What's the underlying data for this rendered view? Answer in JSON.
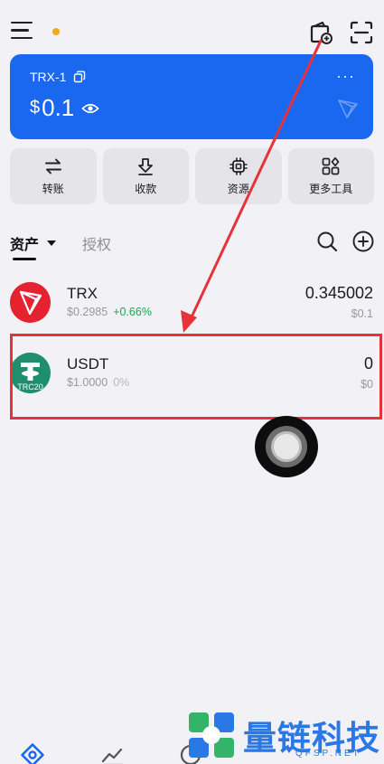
{
  "wallet": {
    "name": "TRX-1",
    "currency_symbol": "$",
    "balance": "0.1",
    "more": "···",
    "card_color": "#1a67f0"
  },
  "actions": [
    {
      "label": "转账",
      "icon": "transfer-icon"
    },
    {
      "label": "收款",
      "icon": "receive-icon"
    },
    {
      "label": "资源",
      "icon": "chip-icon"
    },
    {
      "label": "更多工具",
      "icon": "grid-icon"
    }
  ],
  "tabs": {
    "assets": "资产",
    "authorization": "授权"
  },
  "tokens": [
    {
      "symbol": "TRX",
      "price": "$0.2985",
      "change": "+0.66%",
      "amount": "0.345002",
      "value": "$0.1",
      "logo_color": "#e5222f"
    },
    {
      "symbol": "USDT",
      "price": "$1.0000",
      "change": "0%",
      "amount": "0",
      "value": "$0",
      "badge": "TRC20",
      "logo_color": "#1f8e6f"
    }
  ],
  "annotation": {
    "color": "#e5333a"
  },
  "watermark": {
    "text": "量链科技",
    "sub": "QFSP.NET",
    "color": "#2a77e6"
  }
}
